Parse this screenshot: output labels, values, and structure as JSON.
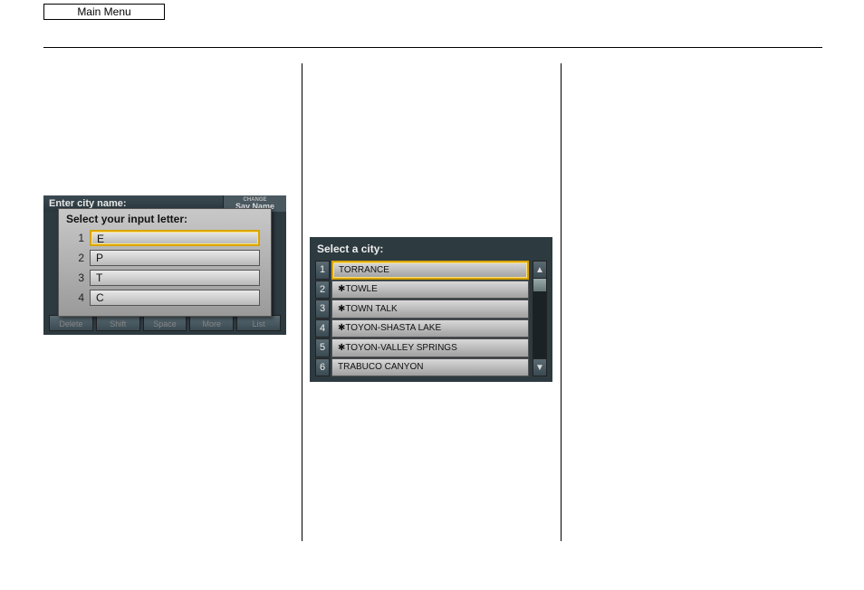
{
  "header": {
    "main_menu": "Main Menu"
  },
  "screen1": {
    "background_title": "Enter city name:",
    "say_name_small": "CHANGE",
    "say_name_big": "Say Name",
    "bottom_buttons": [
      "Delete",
      "Shift",
      "Space",
      "More",
      "List"
    ],
    "popup_title": "Select your input letter:",
    "options": [
      {
        "num": "1",
        "letter": "E",
        "selected": true
      },
      {
        "num": "2",
        "letter": "P",
        "selected": false
      },
      {
        "num": "3",
        "letter": "T",
        "selected": false
      },
      {
        "num": "4",
        "letter": "C",
        "selected": false
      }
    ]
  },
  "screen2": {
    "title": "Select a city:",
    "cities": [
      {
        "num": "1",
        "name": "TORRANCE",
        "selected": true
      },
      {
        "num": "2",
        "name": "✱TOWLE",
        "selected": false
      },
      {
        "num": "3",
        "name": "✱TOWN TALK",
        "selected": false
      },
      {
        "num": "4",
        "name": "✱TOYON-SHASTA LAKE",
        "selected": false
      },
      {
        "num": "5",
        "name": "✱TOYON-VALLEY SPRINGS",
        "selected": false
      },
      {
        "num": "6",
        "name": "TRABUCO CANYON",
        "selected": false
      }
    ],
    "scroll_up": "▲",
    "scroll_down": "▼"
  }
}
